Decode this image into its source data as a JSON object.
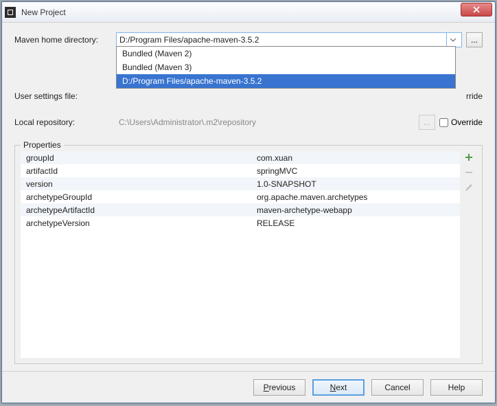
{
  "window": {
    "title": "New Project"
  },
  "form": {
    "maven_home_label": "Maven home directory:",
    "maven_home_value": "D:/Program Files/apache-maven-3.5.2",
    "user_settings_label": "User settings file:",
    "local_repo_label": "Local repository:",
    "local_repo_value": "C:\\Users\\Administrator\\.m2\\repository",
    "override_label": "Override",
    "rrde_partial": "rride"
  },
  "dropdown": {
    "items": [
      "Bundled (Maven 2)",
      "Bundled (Maven 3)",
      "D:/Program Files/apache-maven-3.5.2"
    ]
  },
  "properties": {
    "legend": "Properties",
    "rows": [
      {
        "key": "groupId",
        "value": "com.xuan"
      },
      {
        "key": "artifactId",
        "value": "springMVC"
      },
      {
        "key": "version",
        "value": "1.0-SNAPSHOT"
      },
      {
        "key": "archetypeGroupId",
        "value": "org.apache.maven.archetypes"
      },
      {
        "key": "archetypeArtifactId",
        "value": "maven-archetype-webapp"
      },
      {
        "key": "archetypeVersion",
        "value": "RELEASE"
      }
    ]
  },
  "buttons": {
    "previous_p": "P",
    "previous_rest": "revious",
    "next_n": "N",
    "next_rest": "ext",
    "cancel": "Cancel",
    "help": "Help",
    "ellipsis": "..."
  }
}
